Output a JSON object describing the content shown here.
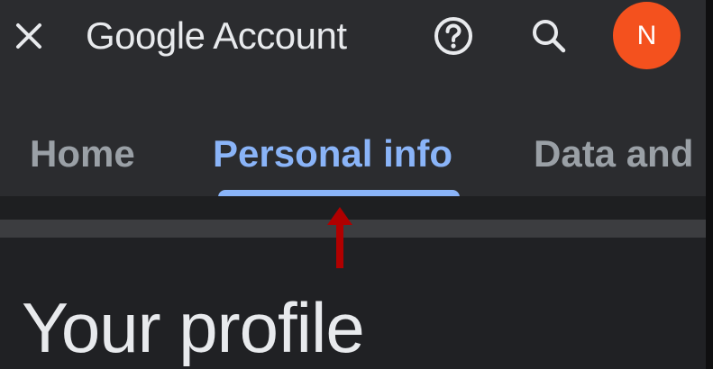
{
  "header": {
    "title": "Google Account",
    "close_icon": "close-icon",
    "help_icon": "help-circle-icon",
    "search_icon": "search-icon",
    "avatar_initial": "N",
    "avatar_color": "#f4511e"
  },
  "tabs": [
    {
      "label": "Home",
      "selected": false
    },
    {
      "label": "Personal info",
      "selected": true
    },
    {
      "label": "Data and",
      "selected": false
    }
  ],
  "annotation": {
    "icon": "red-up-arrow",
    "color": "#b00000"
  },
  "main": {
    "heading": "Your profile"
  },
  "colors": {
    "background": "#202124",
    "header": "#2b2c2f",
    "accent": "#8ab4f8",
    "text": "#e8eaed",
    "muted": "#9aa0a6"
  }
}
